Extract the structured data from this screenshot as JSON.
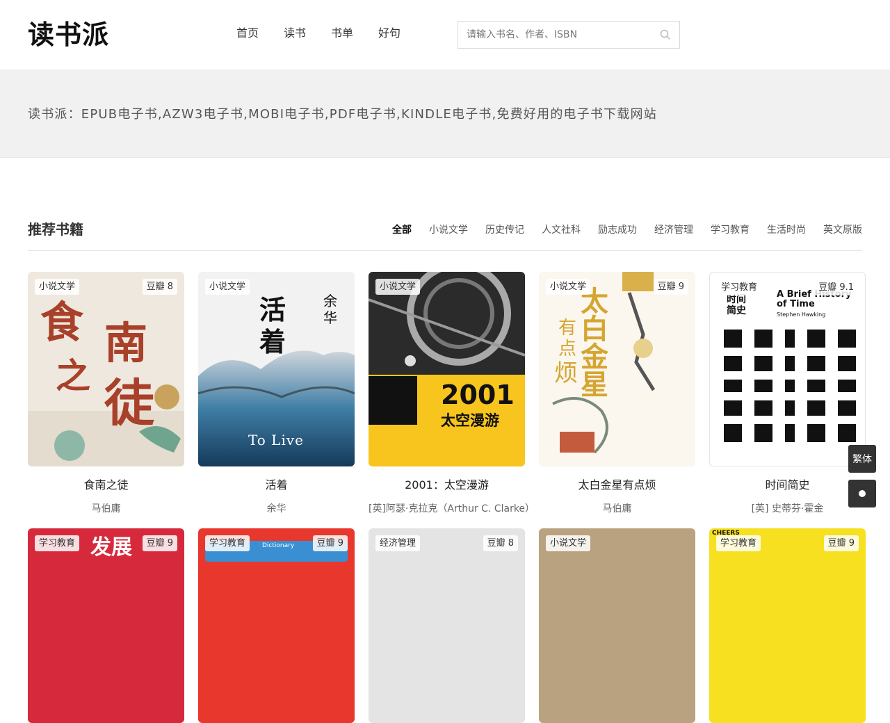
{
  "site": {
    "logo": "读书派",
    "nav": [
      "首页",
      "读书",
      "书单",
      "好句"
    ],
    "search_placeholder": "请输入书名、作者、ISBN"
  },
  "banner": {
    "text": "读书派：EPUB电子书,AZW3电子书,MOBI电子书,PDF电子书,KINDLE电子书,免费好用的电子书下载网站"
  },
  "section": {
    "title": "推荐书籍",
    "filters": [
      "全部",
      "小说文学",
      "历史传记",
      "人文社科",
      "励志成功",
      "经济管理",
      "学习教育",
      "生活时尚",
      "英文原版"
    ],
    "active_filter": "全部"
  },
  "books": [
    {
      "category": "小说文学",
      "score": "豆瓣 8",
      "title": "食南之徒",
      "author": "马伯庸",
      "cover_color": "#efe8df"
    },
    {
      "category": "小说文学",
      "score": "",
      "title": "活着",
      "author": "余华",
      "cover_color": "#f2f2f2"
    },
    {
      "category": "小说文学",
      "score": "",
      "title": "2001：太空漫游",
      "author": "[英]阿瑟·克拉克（Arthur C. Clarke）",
      "cover_color": "#f7c51d"
    },
    {
      "category": "小说文学",
      "score": "豆瓣 9",
      "title": "太白金星有点烦",
      "author": "马伯庸",
      "cover_color": "#fbf7ee"
    },
    {
      "category": "学习教育",
      "score": "豆瓣 9.1",
      "title": "时间简史",
      "author": "[英] 史蒂芬·霍金",
      "cover_color": "#ffffff"
    }
  ],
  "books_row2": [
    {
      "category": "学习教育",
      "score": "豆瓣 9",
      "cover_color": "#d62a3c"
    },
    {
      "category": "学习教育",
      "score": "豆瓣 9",
      "cover_color": "#e8372c"
    },
    {
      "category": "经济管理",
      "score": "豆瓣 8",
      "cover_color": "#e4e4e4"
    },
    {
      "category": "小说文学",
      "score": "",
      "cover_color": "#b8a27f"
    },
    {
      "category": "学习教育",
      "score": "豆瓣 9",
      "cover_color": "#f6e020"
    }
  ],
  "cover_texts": {
    "b1": [
      "食",
      "南",
      "之",
      "徒"
    ],
    "b2": [
      "活",
      "着",
      "余",
      "华",
      "To Live"
    ],
    "b3": [
      "2001",
      "太空漫游"
    ],
    "b4": [
      "太",
      "白",
      "金",
      "星",
      "有",
      "点",
      "烦"
    ],
    "b5": [
      "时间",
      "简史",
      "A Brief History",
      "of Time",
      "Stephen Hawking"
    ],
    "r2": [
      "发展",
      "Dictionary",
      "CHEERS"
    ]
  },
  "floating": {
    "traditional_label": "繁体"
  }
}
